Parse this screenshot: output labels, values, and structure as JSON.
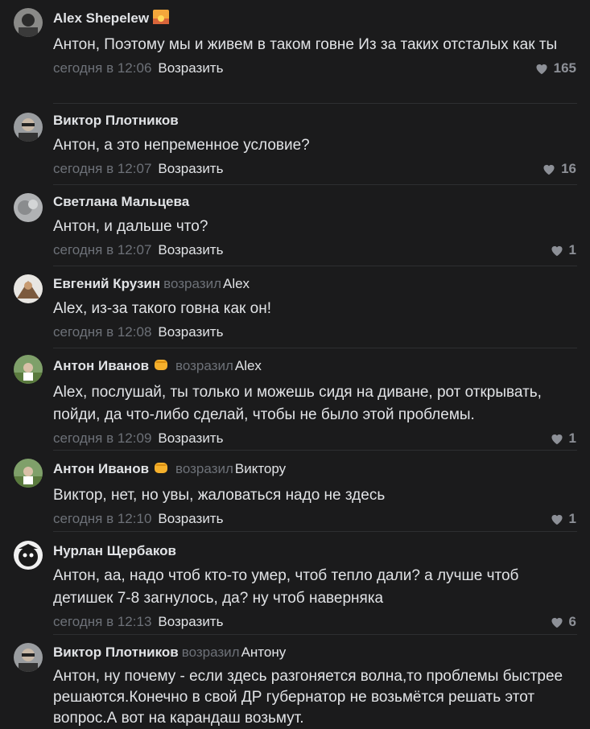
{
  "reply_label": "Возразить",
  "replied_word": "возразил",
  "comments": [
    {
      "author": "Alex Shepelew",
      "text": "Антон, Поэтому мы и живем в таком говне Из за таких отсталых как ты",
      "time": "сегодня в 12:06",
      "likes": "165",
      "reply_to": ""
    },
    {
      "author": "Виктор Плотников",
      "text": "Антон, а это непременное условие?",
      "time": "сегодня в 12:07",
      "likes": "16",
      "reply_to": ""
    },
    {
      "author": "Светлана Мальцева",
      "text": "Антон, и дальше что?",
      "time": "сегодня в 12:07",
      "likes": "1",
      "reply_to": ""
    },
    {
      "author": "Евгений Крузин",
      "text": "Alex, из-за такого говна как он!",
      "time": "сегодня в 12:08",
      "likes": "",
      "reply_to": "Alex"
    },
    {
      "author": "Антон Иванов",
      "text": "Alex, послушай, ты только и можешь сидя на диване, рот открывать, пойди, да что-либо сделай, чтобы не было этой проблемы.",
      "time": "сегодня в 12:09",
      "likes": "1",
      "reply_to": "Alex"
    },
    {
      "author": "Антон Иванов",
      "text": "Виктор, нет, но увы, жаловаться надо не здесь",
      "time": "сегодня в 12:10",
      "likes": "1",
      "reply_to": "Виктору"
    },
    {
      "author": "Нурлан Щербаков",
      "text": "Антон, аа, надо чтоб кто-то умер, чтоб тепло дали? а лучше чтоб детишек 7-8 загнулось, да? ну чтоб наверняка",
      "time": "сегодня в 12:13",
      "likes": "6",
      "reply_to": ""
    },
    {
      "author": "Виктор Плотников",
      "text": "Антон, ну почему - если здесь разгоняется волна,то проблемы быстрее решаются.Конечно в свой ДР губернатор не возьмётся решать этот вопрос.А вот на карандаш возьмут.",
      "time": "",
      "likes": "",
      "reply_to": "Антону"
    }
  ]
}
